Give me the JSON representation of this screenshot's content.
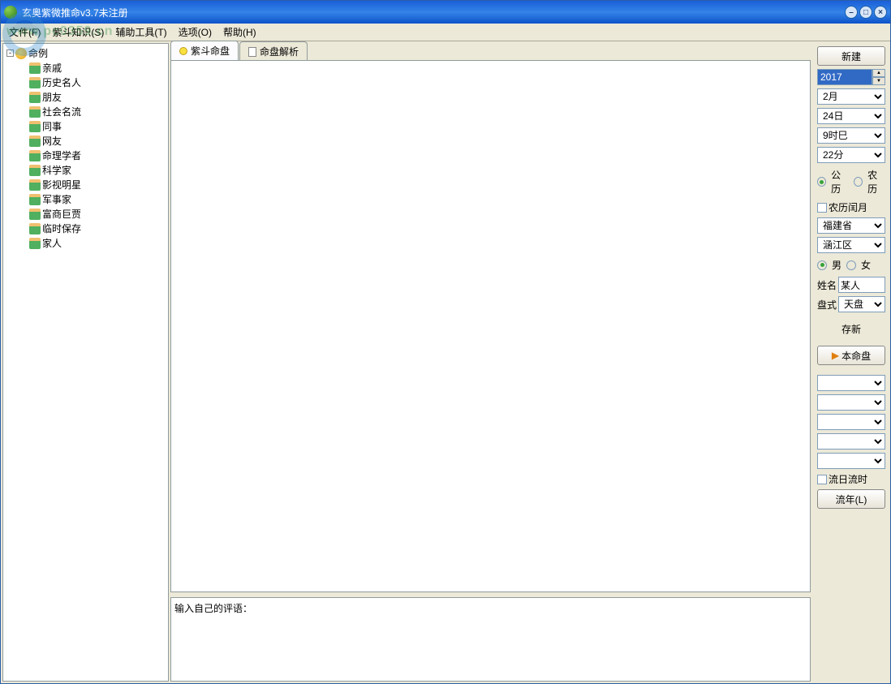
{
  "title": "玄奥紫微推命v3.7未注册",
  "menu": {
    "file": "文件(F)",
    "knowledge": "紫斗知识(S)",
    "tools": "辅助工具(T)",
    "options": "选项(O)",
    "help": "帮助(H)"
  },
  "watermark": "www.pc0359.cn",
  "tree": {
    "root": "命例",
    "items": [
      "亲戚",
      "历史名人",
      "朋友",
      "社会名流",
      "同事",
      "网友",
      "命理学者",
      "科学家",
      "影视明星",
      "军事家",
      "富商巨贾",
      "临时保存",
      "家人"
    ]
  },
  "tabs": {
    "t1": "紫斗命盘",
    "t2": "命盘解析"
  },
  "comment_placeholder": "输入自己的评语：",
  "right": {
    "new_btn": "新建",
    "year": "2017",
    "month": "2月",
    "day": "24日",
    "hour": "9时巳",
    "minute": "22分",
    "cal_solar": "公历",
    "cal_lunar": "农历",
    "leap": "农历闰月",
    "province": "福建省",
    "district": "涵江区",
    "male": "男",
    "female": "女",
    "name_lbl": "姓名",
    "name_val": "某人",
    "plate_lbl": "盘式",
    "plate_val": "天盘",
    "save_new": "存新",
    "main_plate": "本命盘",
    "flow_chk": "流日流时",
    "flow_btn": "流年(L)"
  }
}
